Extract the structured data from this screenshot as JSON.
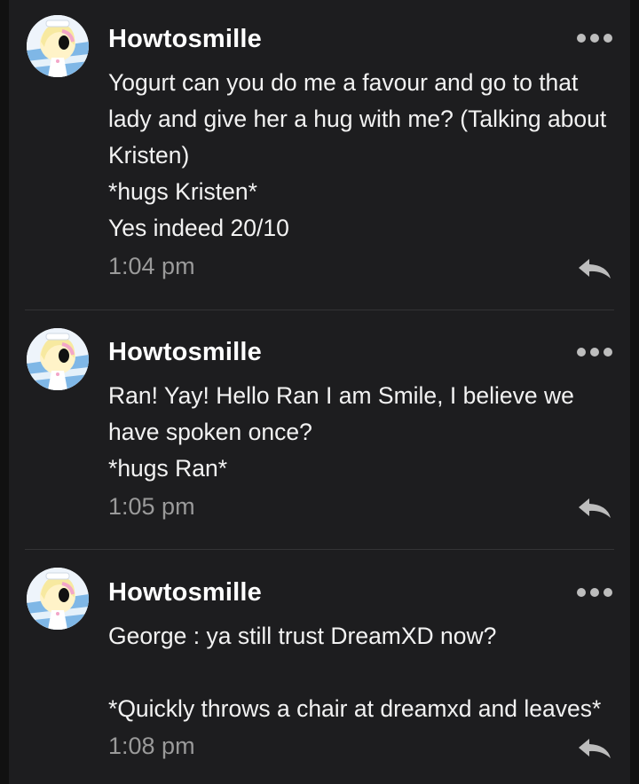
{
  "colors": {
    "background": "#1d1d1f",
    "username": "#ffffff",
    "text": "#f2f2f2",
    "timestamp": "#9a9a9a",
    "icon": "#bdbdbd"
  },
  "comments": [
    {
      "username": "Howtosmille",
      "lines": [
        "Yogurt can you do me a favour and go to that",
        "lady and give her a hug with me? (Talking about",
        "Kristen)",
        "*hugs Kristen*",
        "Yes indeed 20/10"
      ],
      "time": "1:04 pm",
      "menu_icon": "more-dots-icon",
      "reply_icon": "reply-arrow-icon"
    },
    {
      "username": "Howtosmille",
      "lines": [
        "Ran! Yay! Hello Ran I am Smile, I believe we",
        "have spoken once?",
        "*hugs Ran*"
      ],
      "time": "1:05 pm",
      "menu_icon": "more-dots-icon",
      "reply_icon": "reply-arrow-icon"
    },
    {
      "username": "Howtosmille",
      "lines": [
        "George : ya still trust DreamXD now?",
        "",
        "*Quickly throws a chair at dreamxd and leaves*"
      ],
      "time": "1:08 pm",
      "menu_icon": "more-dots-icon",
      "reply_icon": "reply-arrow-icon"
    }
  ]
}
